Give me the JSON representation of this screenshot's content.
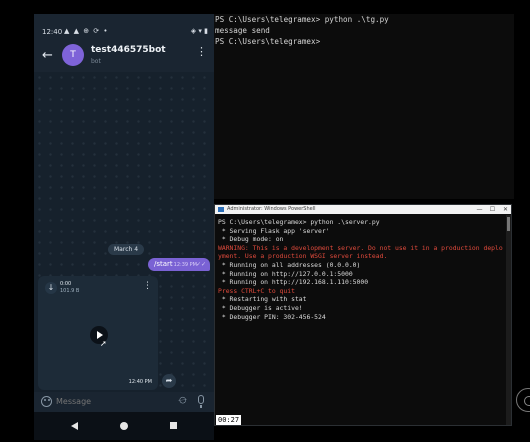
{
  "phone": {
    "status_time": "12:40",
    "status_left_icons": "▲ ▲ ⊕ ⟳ •",
    "status_right_icons": "◈ ▾ ▮",
    "chat_name": "test446575bot",
    "chat_sub": "bot",
    "avatar_letter": "T",
    "date_chip": "March 4",
    "outgoing": {
      "text": "/start",
      "time": "12:39 PM",
      "ticks": "✓✓"
    },
    "video": {
      "duration": "0:00",
      "size": "101.9 B",
      "time": "12:40 PM"
    },
    "composer_placeholder": "Message",
    "accent_color": "#7a62d4"
  },
  "term1": {
    "lines": [
      "PS C:\\Users\\telegramex> python .\\tg.py",
      "message send",
      "PS C:\\Users\\telegramex>"
    ]
  },
  "term2": {
    "title": "Administrator: Windows PowerShell",
    "buttons": [
      "—",
      "☐",
      "✕"
    ],
    "lines": [
      {
        "text": "PS C:\\Users\\telegramex> python .\\server.py",
        "color": "white"
      },
      {
        "text": " * Serving Flask app 'server'",
        "color": "white"
      },
      {
        "text": " * Debug mode: on",
        "color": "white"
      },
      {
        "text": "WARNING: This is a development server. Do not use it in a production deplo",
        "color": "red"
      },
      {
        "text": "yment. Use a production WSGI server instead.",
        "color": "red"
      },
      {
        "text": " * Running on all addresses (0.0.0.0)",
        "color": "white"
      },
      {
        "text": " * Running on http://127.0.0.1:5000",
        "color": "white"
      },
      {
        "text": " * Running on http://192.168.1.110:5000",
        "color": "white"
      },
      {
        "text": "Press CTRL+C to quit",
        "color": "red"
      },
      {
        "text": " * Restarting with stat",
        "color": "white"
      },
      {
        "text": " * Debugger is active!",
        "color": "white"
      },
      {
        "text": " * Debugger PIN: 302-456-524",
        "color": "white"
      }
    ]
  },
  "recording_time": "00:27"
}
